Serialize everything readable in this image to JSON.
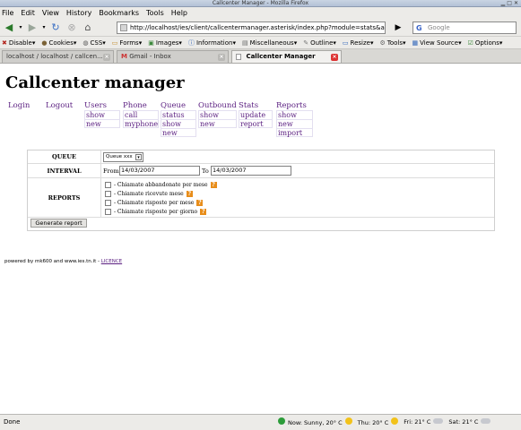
{
  "window": {
    "title": "Callcenter Manager - Mozilla Firefox"
  },
  "menubar": [
    "File",
    "Edit",
    "View",
    "History",
    "Bookmarks",
    "Tools",
    "Help"
  ],
  "navbar": {
    "url": "http://localhost/ies/client/callcentermanager.asterisk/index.php?module=stats&action=",
    "search_placeholder": "Google"
  },
  "devbar": [
    "Disable",
    "Cookies",
    "CSS",
    "Forms",
    "Images",
    "Information",
    "Miscellaneous",
    "Outline",
    "Resize",
    "Tools",
    "View Source",
    "Options"
  ],
  "tabs": [
    {
      "label": "localhost / localhost / callcen..."
    },
    {
      "label": "Gmail - Inbox"
    },
    {
      "label": "Callcenter Manager"
    }
  ],
  "page": {
    "title": "Callcenter manager",
    "menus": {
      "login": {
        "header": "Login"
      },
      "logout": {
        "header": "Logout"
      },
      "users": {
        "header": "Users",
        "items": [
          "show",
          "new"
        ]
      },
      "phone": {
        "header": "Phone",
        "items": [
          "call",
          "myphone"
        ]
      },
      "queue": {
        "header": "Queue",
        "items": [
          "status",
          "show",
          "new"
        ]
      },
      "outbound": {
        "header": "Outbound",
        "items": [
          "show",
          "new"
        ]
      },
      "stats": {
        "header": "Stats",
        "items": [
          "update",
          "report"
        ]
      },
      "reports": {
        "header": "Reports",
        "items": [
          "show",
          "new",
          "import"
        ]
      }
    },
    "form": {
      "queue_label": "QUEUE",
      "queue_value": "Queue xxx",
      "interval_label": "INTERVAL",
      "from_label": "From",
      "from_value": "14/03/2007",
      "to_label": "To",
      "to_value": "14/03/2007",
      "reports_label": "REPORTS",
      "reports": [
        "- Chiamate abbandonate per mese",
        "- Chiamate ricevute mese",
        "- Chiamate risposte per mese",
        "- Chiamate risposte per giorno"
      ],
      "button": "Generate report"
    },
    "footer": {
      "text": "powered by mk600 and www.ies.tn.it - ",
      "link": "LICENCE"
    }
  },
  "statusbar": {
    "status": "Done",
    "weather": [
      {
        "label": "Now: Sunny, 20° C"
      },
      {
        "label": "Thu: 20° C"
      },
      {
        "label": "Fri: 21° C"
      },
      {
        "label": "Sat: 21° C"
      }
    ]
  }
}
